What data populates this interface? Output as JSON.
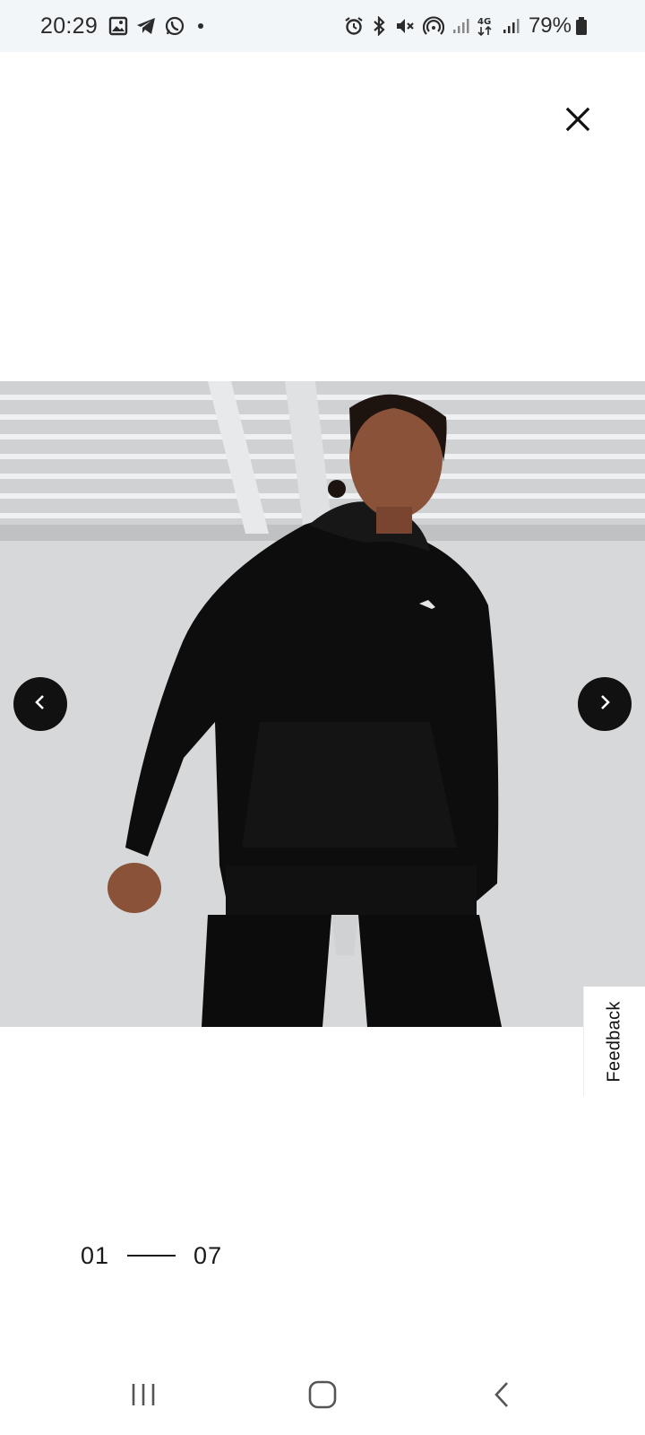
{
  "status_bar": {
    "time": "20:29",
    "battery_percent": "79%",
    "network_label": "4G",
    "left_icons": [
      "gallery-icon",
      "telegram-icon",
      "whatsapp-icon",
      "dot-icon"
    ],
    "right_icons": [
      "alarm-icon",
      "bluetooth-icon",
      "mute-icon",
      "hotspot-icon",
      "signal-icon",
      "network-4g-icon",
      "signal-icon",
      "battery-icon"
    ]
  },
  "close": {
    "icon": "close-icon"
  },
  "carousel": {
    "prev_icon": "chevron-left-icon",
    "next_icon": "chevron-right-icon",
    "image_subject": "model wearing black hoodie and black leggings"
  },
  "feedback": {
    "label": "Feedback"
  },
  "pagination": {
    "current": "01",
    "total": "07"
  },
  "nav_bar": {
    "recents_icon": "recents-icon",
    "home_icon": "home-icon",
    "back_icon": "back-icon"
  },
  "colors": {
    "status_bar_bg": "#f3f6f9",
    "button_dark": "#111111",
    "text": "#1a1a1a"
  }
}
